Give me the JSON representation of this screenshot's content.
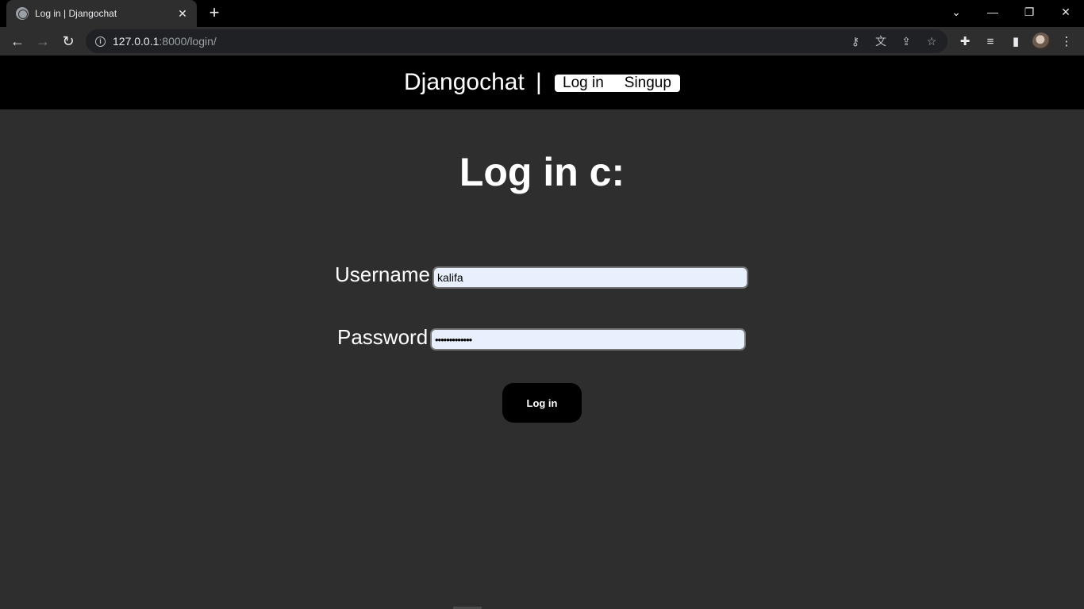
{
  "browser": {
    "tab_title": "Log in | Djangochat",
    "tab_close": "✕",
    "new_tab": "+",
    "url_host": "127.0.0.1",
    "url_rest": ":8000/login/",
    "icons": {
      "back": "←",
      "forward": "→",
      "reload": "↻",
      "info": "i",
      "key": "⚷",
      "translate": "文",
      "share": "⇪",
      "bookmark": "☆",
      "extensions": "✚",
      "media": "≡",
      "sidepanel": "▮",
      "menu": "⋮",
      "tab_search": "⌄",
      "minimize": "—",
      "restore": "❐",
      "close": "✕"
    }
  },
  "header": {
    "brand": "Djangochat",
    "separator": "|",
    "nav": {
      "login": "Log in",
      "signup": "Singup"
    }
  },
  "main": {
    "title": "Log in c:",
    "form": {
      "username_label": "Username",
      "username_value": "kalifa",
      "password_label": "Password",
      "password_value": "•••••••••••••",
      "submit_label": "Log in"
    }
  },
  "colors": {
    "page_bg": "#2e2e2e",
    "header_bg": "#000000",
    "input_bg": "#e8f0fe",
    "text": "#ffffff"
  }
}
